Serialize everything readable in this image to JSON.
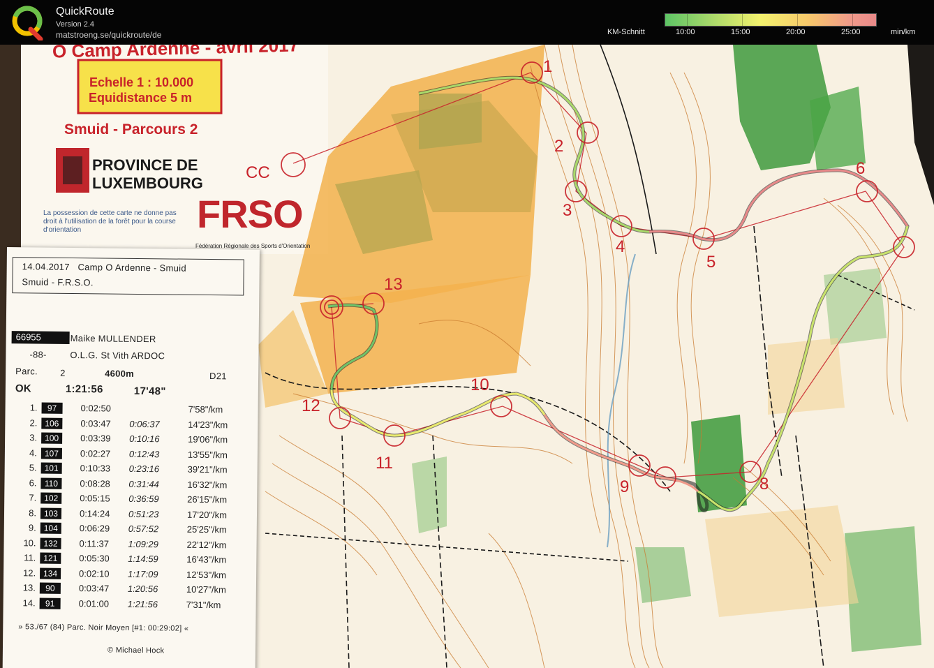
{
  "app": {
    "title": "QuickRoute",
    "version": "Version 2.4",
    "url": "matstroeng.se/quickroute/de"
  },
  "pace_legend": {
    "label": "KM-Schnitt",
    "ticks": [
      "10:00",
      "15:00",
      "20:00",
      "25:00"
    ],
    "unit": "min/km",
    "colors": [
      "#5ec466",
      "#a9d96a",
      "#f3f26e",
      "#f7c86c",
      "#e88989"
    ]
  },
  "map_header": {
    "event_title": "O Camp Ardenne - avril 2017",
    "scale": "Echelle 1 : 10.000",
    "equidistance": "Equidistance 5 m",
    "course": "Smuid - Parcours 2",
    "province_line1": "PROVINCE DE",
    "province_line2": "LUXEMBOURG",
    "note": "La possession de cette carte ne donne pas droit à l'utilisation de la forêt pour la course d'orientation",
    "frso_logo": "FRSO",
    "frso_full": "Fédération Régionale des Sports d'Orientation",
    "start_label": "CC"
  },
  "controls": [
    "1",
    "2",
    "3",
    "4",
    "5",
    "6",
    "8",
    "9",
    "10",
    "11",
    "12",
    "13"
  ],
  "split_slip": {
    "line1": "14.04.2017   Camp O Ardenne - Smuid",
    "line2": "Smuid - F.R.S.O.",
    "bib": "66955",
    "name": "Maike MULLENDER",
    "club_code": "-88-",
    "club": "O.L.G. St Vith ARDOC",
    "parc_label": "Parc.",
    "parc": "2",
    "distance": "4600m",
    "category": "D21",
    "status": "OK",
    "total_time": "1:21:56",
    "avg_pace": "17'48\"",
    "splits": [
      {
        "n": "1.",
        "code": "97",
        "leg": "0:02:50",
        "cum": "",
        "pace": "7'58\"/km"
      },
      {
        "n": "2.",
        "code": "106",
        "leg": "0:03:47",
        "cum": "0:06:37",
        "pace": "14'23\"/km"
      },
      {
        "n": "3.",
        "code": "100",
        "leg": "0:03:39",
        "cum": "0:10:16",
        "pace": "19'06\"/km"
      },
      {
        "n": "4.",
        "code": "107",
        "leg": "0:02:27",
        "cum": "0:12:43",
        "pace": "13'55\"/km"
      },
      {
        "n": "5.",
        "code": "101",
        "leg": "0:10:33",
        "cum": "0:23:16",
        "pace": "39'21\"/km"
      },
      {
        "n": "6.",
        "code": "110",
        "leg": "0:08:28",
        "cum": "0:31:44",
        "pace": "16'32\"/km"
      },
      {
        "n": "7.",
        "code": "102",
        "leg": "0:05:15",
        "cum": "0:36:59",
        "pace": "26'15\"/km"
      },
      {
        "n": "8.",
        "code": "103",
        "leg": "0:14:24",
        "cum": "0:51:23",
        "pace": "17'20\"/km"
      },
      {
        "n": "9.",
        "code": "104",
        "leg": "0:06:29",
        "cum": "0:57:52",
        "pace": "25'25\"/km"
      },
      {
        "n": "10.",
        "code": "132",
        "leg": "0:11:37",
        "cum": "1:09:29",
        "pace": "22'12\"/km"
      },
      {
        "n": "11.",
        "code": "121",
        "leg": "0:05:30",
        "cum": "1:14:59",
        "pace": "16'43\"/km"
      },
      {
        "n": "12.",
        "code": "134",
        "leg": "0:02:10",
        "cum": "1:17:09",
        "pace": "12'53\"/km"
      },
      {
        "n": "13.",
        "code": "90",
        "leg": "0:03:47",
        "cum": "1:20:56",
        "pace": "10'27\"/km"
      },
      {
        "n": "14.",
        "code": "91",
        "leg": "0:01:00",
        "cum": "1:21:56",
        "pace": "7'31\"/km"
      }
    ],
    "footer": "» 53./67 (84) Parc. Noir Moyen [#1: 00:29:02] «",
    "credit": "© Michael Hock"
  }
}
